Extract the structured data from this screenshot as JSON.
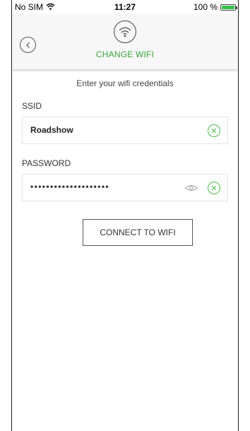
{
  "status_bar": {
    "carrier": "No SIM",
    "time": "11:27",
    "battery_percent": "100 %",
    "battery_level": 1.0
  },
  "header": {
    "title": "CHANGE WIFI",
    "icon": "wifi-icon",
    "back_icon": "back-icon"
  },
  "form": {
    "subtitle": "Enter your wifi credentials",
    "ssid_label": "SSID",
    "ssid_value": "Roadshow",
    "password_label": "PASSWORD",
    "password_value": "••••••••••••••••••••"
  },
  "connect_label": "CONNECT TO WIFI",
  "colors": {
    "accent": "#3aa33a",
    "battery": "#33c24d",
    "header_bg": "#f7f7f7"
  }
}
